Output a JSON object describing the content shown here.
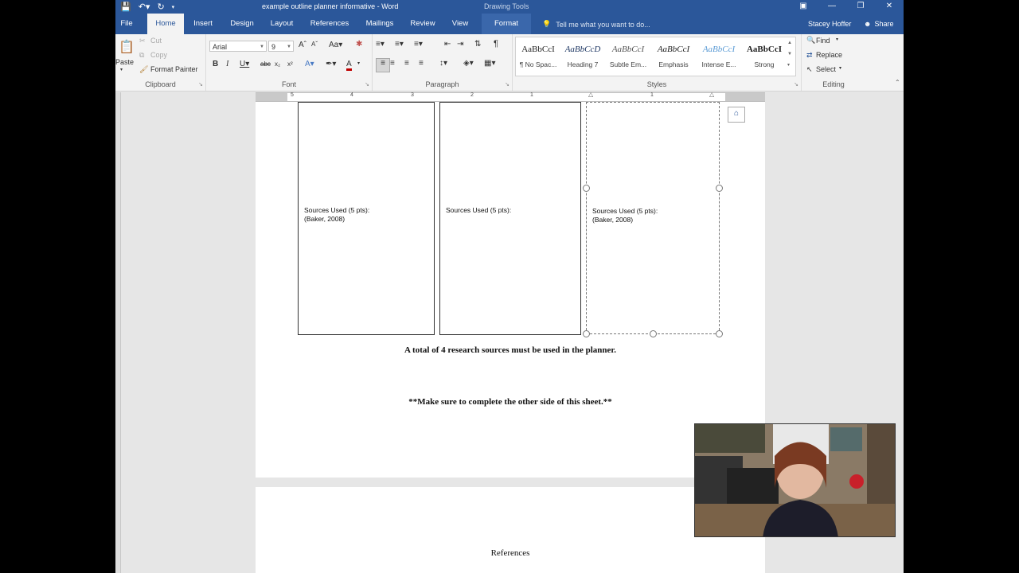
{
  "window": {
    "title": "example outline planner informative - Word",
    "context_tab_group": "Drawing Tools",
    "user": "Stacey Hoffer",
    "share_label": "Share",
    "tell_me_placeholder": "Tell me what you want to do..."
  },
  "tabs": [
    {
      "label": "File"
    },
    {
      "label": "Home"
    },
    {
      "label": "Insert"
    },
    {
      "label": "Design"
    },
    {
      "label": "Layout"
    },
    {
      "label": "References"
    },
    {
      "label": "Mailings"
    },
    {
      "label": "Review"
    },
    {
      "label": "View"
    },
    {
      "label": "Format"
    }
  ],
  "ribbon": {
    "clipboard": {
      "label": "Clipboard",
      "paste": "Paste",
      "cut": "Cut",
      "copy": "Copy",
      "format_painter": "Format Painter"
    },
    "font": {
      "label": "Font",
      "font_name": "Arial",
      "font_size": "9"
    },
    "paragraph": {
      "label": "Paragraph"
    },
    "styles": {
      "label": "Styles",
      "items": [
        {
          "sample": "AaBbCcI",
          "name": "¶ No Spac..."
        },
        {
          "sample": "AaBbCcD",
          "name": "Heading 7"
        },
        {
          "sample": "AaBbCcI",
          "name": "Subtle Em..."
        },
        {
          "sample": "AaBbCcI",
          "name": "Emphasis"
        },
        {
          "sample": "AaBbCcI",
          "name": "Intense E..."
        },
        {
          "sample": "AaBbCcI",
          "name": "Strong"
        }
      ]
    },
    "editing": {
      "label": "Editing",
      "find": "Find",
      "replace": "Replace",
      "select": "Select"
    }
  },
  "ruler_numbers": [
    "5",
    "4",
    "3",
    "2",
    "1",
    "1"
  ],
  "document": {
    "boxes": [
      {
        "line1": "Sources Used (5 pts):",
        "line2": "(Baker, 2008)"
      },
      {
        "line1": "Sources Used (5 pts):",
        "line2": ""
      },
      {
        "line1": "Sources Used (5 pts):",
        "line2": "(Baker, 2008)"
      }
    ],
    "sources_note": "A total of 4 research sources must be used in the planner.",
    "reminder": "**Make sure to complete the other side of this sheet.**",
    "next_page_heading": "References"
  },
  "colors": {
    "word_blue": "#2b579a",
    "ribbon_bg": "#f3f3f3",
    "canvas_bg": "#e6e6e6"
  }
}
